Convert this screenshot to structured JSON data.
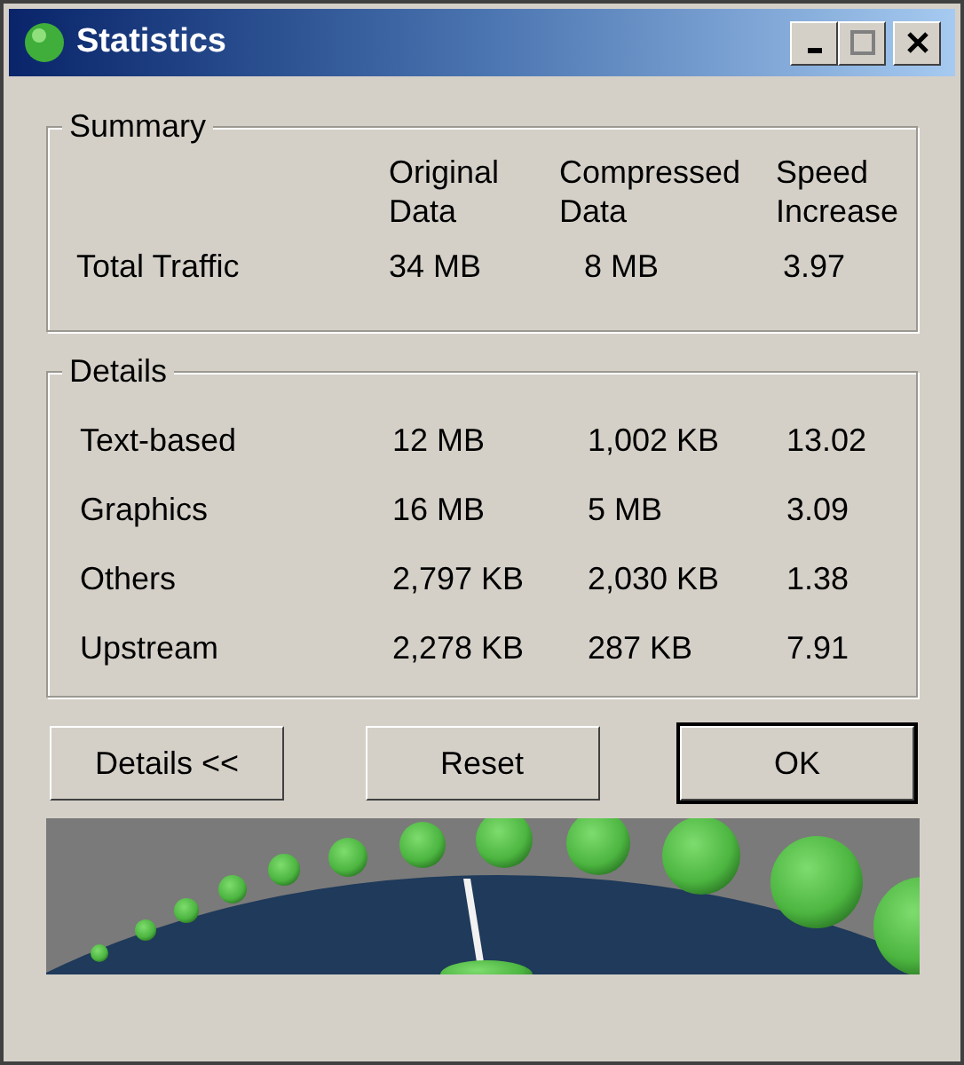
{
  "window": {
    "title": "Statistics"
  },
  "summary": {
    "title": "Summary",
    "columns": [
      "Original Data",
      "Compressed Data",
      "Speed Increase"
    ],
    "rows": [
      {
        "label": "Total Traffic",
        "original": "34 MB",
        "compressed": "8 MB",
        "speed": "3.97"
      }
    ]
  },
  "details": {
    "title": "Details",
    "rows": [
      {
        "label": "Text-based",
        "original": "12 MB",
        "compressed": "1,002 KB",
        "speed": "13.02"
      },
      {
        "label": "Graphics",
        "original": "16 MB",
        "compressed": "5 MB",
        "speed": "3.09"
      },
      {
        "label": "Others",
        "original": "2,797 KB",
        "compressed": "2,030 KB",
        "speed": "1.38"
      },
      {
        "label": "Upstream",
        "original": "2,278 KB",
        "compressed": "287 KB",
        "speed": "7.91"
      }
    ]
  },
  "buttons": [
    {
      "label": "Details <<",
      "default": false
    },
    {
      "label": "Reset",
      "default": false
    },
    {
      "label": "OK",
      "default": true
    }
  ]
}
